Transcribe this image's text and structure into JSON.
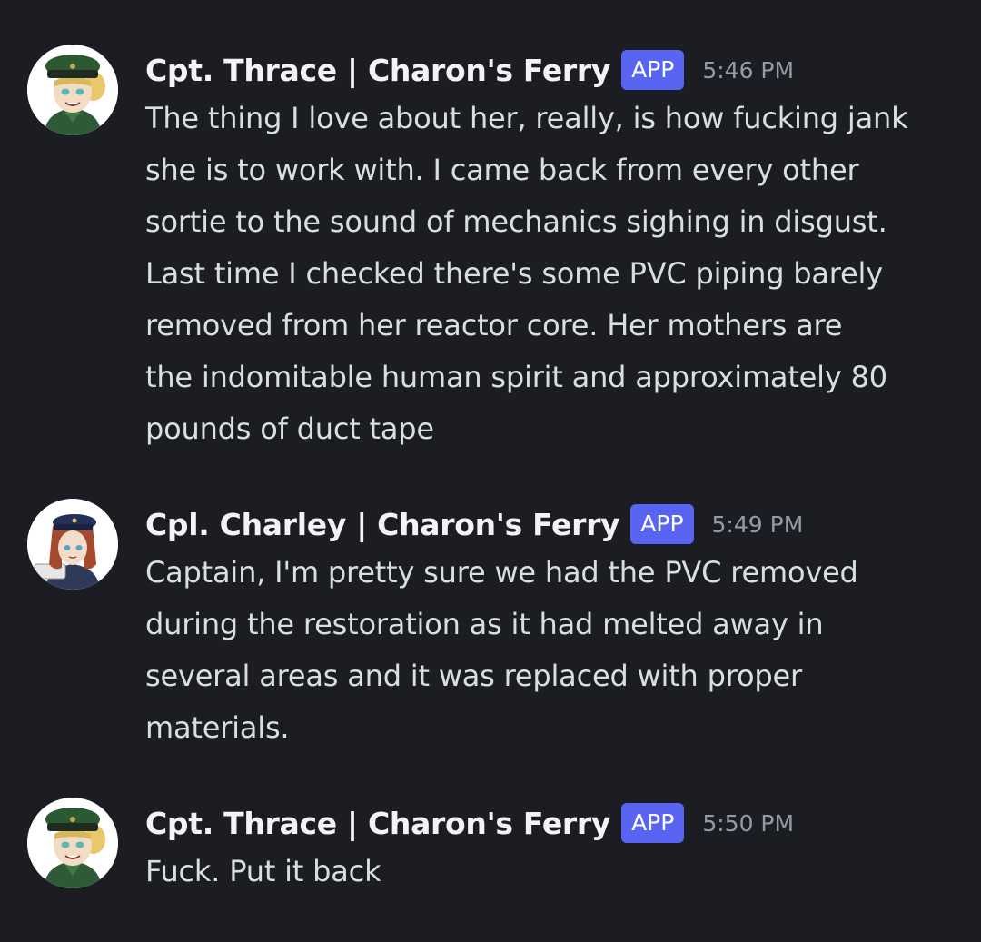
{
  "colors": {
    "background": "#1c1d22",
    "username": "#f2f3f5",
    "text": "#dbdee1",
    "timestamp": "#949ba4",
    "app_badge": "#5865f2"
  },
  "messages": [
    {
      "author": "Cpt. Thrace | Charon's Ferry",
      "badge": "APP",
      "time": "5:46 PM",
      "avatar_icon": "captain-thrace-avatar-icon",
      "lines": [
        "The thing I love about her, really, is how fucking jank",
        "she is to work with. I came back from every other",
        "sortie to the sound of mechanics sighing in disgust.",
        "Last time I checked there's some PVC piping barely",
        "removed from her reactor core. Her mothers are",
        "the indomitable human spirit and approximately 80",
        "pounds of duct tape"
      ]
    },
    {
      "author": "Cpl. Charley | Charon's Ferry",
      "badge": "APP",
      "time": "5:49 PM",
      "avatar_icon": "corporal-charley-avatar-icon",
      "lines": [
        "Captain, I'm pretty sure we had the PVC removed",
        "during the restoration as it had melted away in",
        "several areas and it was replaced with proper",
        "materials."
      ]
    },
    {
      "author": "Cpt. Thrace | Charon's Ferry",
      "badge": "APP",
      "time": "5:50 PM",
      "avatar_icon": "captain-thrace-avatar-icon",
      "lines": [
        "Fuck. Put it back"
      ]
    }
  ]
}
